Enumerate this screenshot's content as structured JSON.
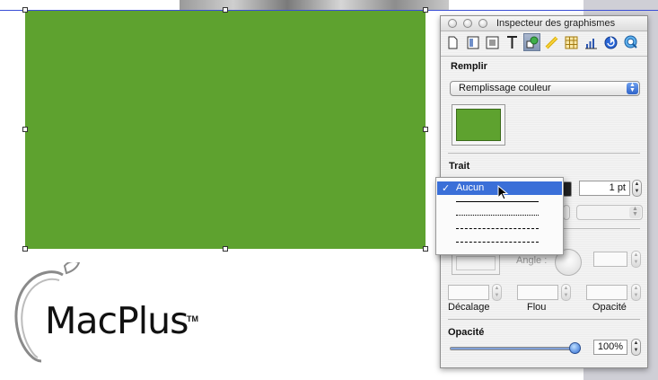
{
  "inspector": {
    "title": "Inspecteur des graphismes",
    "tools": [
      "document-icon",
      "layout-icon",
      "wrap-icon",
      "text-icon",
      "graphic-icon",
      "metrics-icon",
      "table-icon",
      "chart-icon",
      "link-icon",
      "quicktime-icon"
    ],
    "fill": {
      "label": "Remplir",
      "type_value": "Remplissage couleur",
      "color": "#5ea22f"
    },
    "stroke": {
      "label": "Trait",
      "width_value": "1 pt"
    },
    "shadow": {
      "angle_label": "Angle :",
      "offset_label": "Décalage",
      "blur_label": "Flou",
      "opacity_label": "Opacité"
    },
    "opacity": {
      "label": "Opacité",
      "value": "100%",
      "level": 1.0
    }
  },
  "line_style_menu": {
    "selected_label": "Aucun",
    "check": "✓",
    "items": [
      "Aucun",
      "solid",
      "dotted",
      "dashed-fine",
      "dashed"
    ]
  },
  "logo": {
    "text": "MacPlus",
    "tm": "TM"
  },
  "colors": {
    "shape_fill": "#5ea22f",
    "menu_highlight": "#3a6fd8",
    "guide": "#3b4fd6"
  }
}
